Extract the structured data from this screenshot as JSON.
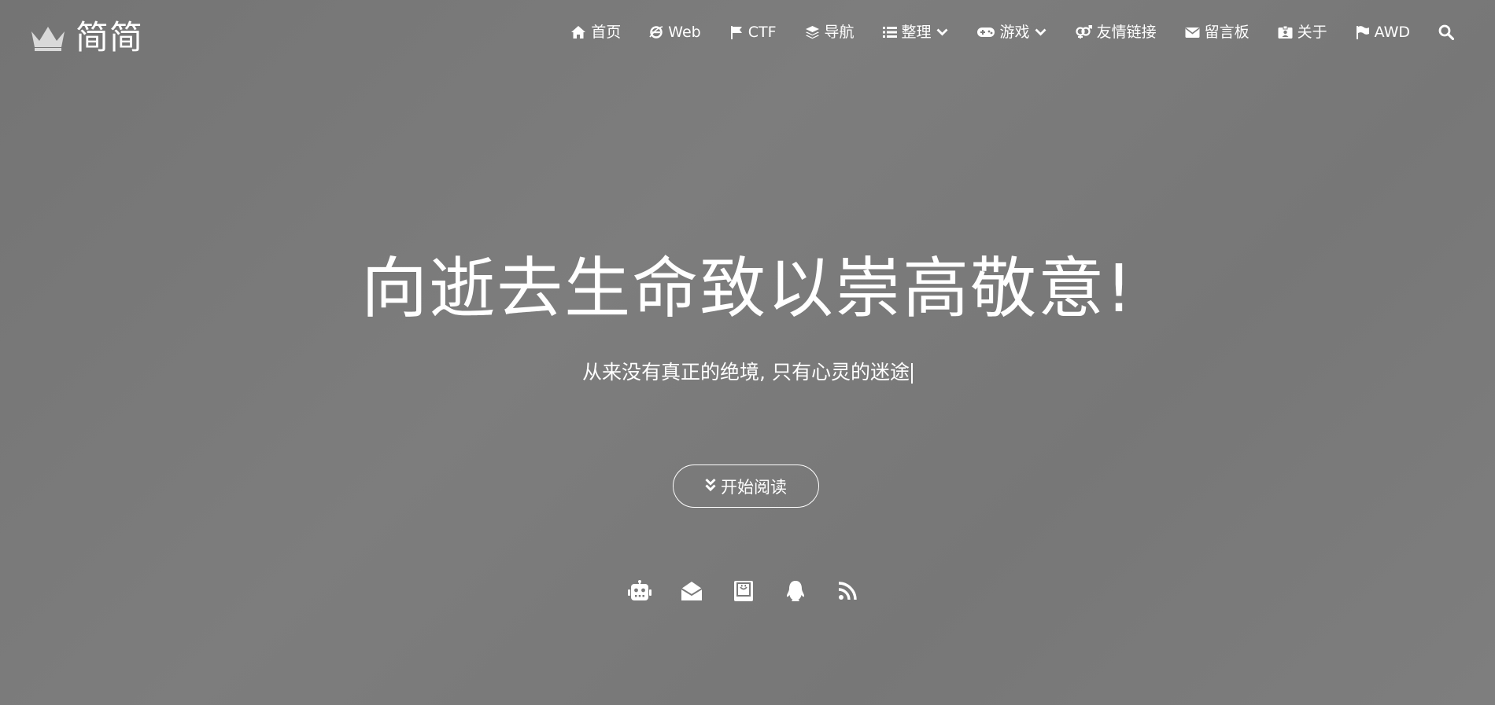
{
  "brand": {
    "logo_icon": "crown-icon",
    "name": "简简"
  },
  "nav": {
    "items": [
      {
        "icon": "home-icon",
        "label": "首页"
      },
      {
        "icon": "ie-icon",
        "label": "Web"
      },
      {
        "icon": "flag-icon",
        "label": "CTF"
      },
      {
        "icon": "layers-icon",
        "label": "导航"
      },
      {
        "icon": "list-icon",
        "label": "整理",
        "dropdown": true
      },
      {
        "icon": "gamepad-icon",
        "label": "游戏",
        "dropdown": true
      },
      {
        "icon": "gender-icon",
        "label": "友情链接"
      },
      {
        "icon": "envelope-icon",
        "label": "留言板"
      },
      {
        "icon": "id-card-icon",
        "label": "关于"
      },
      {
        "icon": "flag-alt-icon",
        "label": "AWD"
      }
    ],
    "search_icon": "search-icon"
  },
  "hero": {
    "title": "向逝去生命致以崇高敬意!",
    "subtitle": "从来没有真正的绝境, 只有心灵的迷途",
    "button_label": "开始阅读",
    "button_icon": "double-chevron-down-icon"
  },
  "socials": [
    {
      "icon": "robot-icon"
    },
    {
      "icon": "envelope-open-icon"
    },
    {
      "icon": "bookmark-icon"
    },
    {
      "icon": "qq-icon"
    },
    {
      "icon": "rss-icon"
    }
  ],
  "colors": {
    "background": "#7a7a7a",
    "text": "#ffffff"
  }
}
